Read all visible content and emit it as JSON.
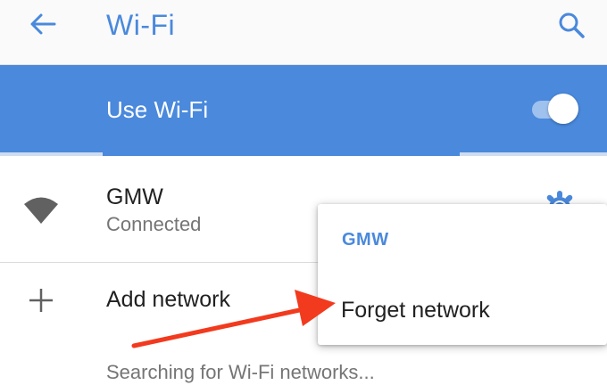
{
  "header": {
    "title": "Wi-Fi",
    "back_icon": "arrow-left-icon",
    "search_icon": "search-icon",
    "accent_color": "#4a89dc"
  },
  "wifi_toggle": {
    "label": "Use Wi-Fi",
    "state": "on",
    "background_color": "#4a89dc"
  },
  "networks": [
    {
      "name": "GMW",
      "status": "Connected",
      "icon": "wifi-signal-icon",
      "settings_icon": "gear-icon"
    }
  ],
  "add_network": {
    "label": "Add network",
    "icon": "plus-icon"
  },
  "searching_text": "Searching for Wi-Fi networks...",
  "context_menu": {
    "title": "GMW",
    "items": [
      "Forget network"
    ]
  },
  "annotation": {
    "type": "arrow",
    "color": "#f23a1e",
    "points_to": "Forget network"
  }
}
